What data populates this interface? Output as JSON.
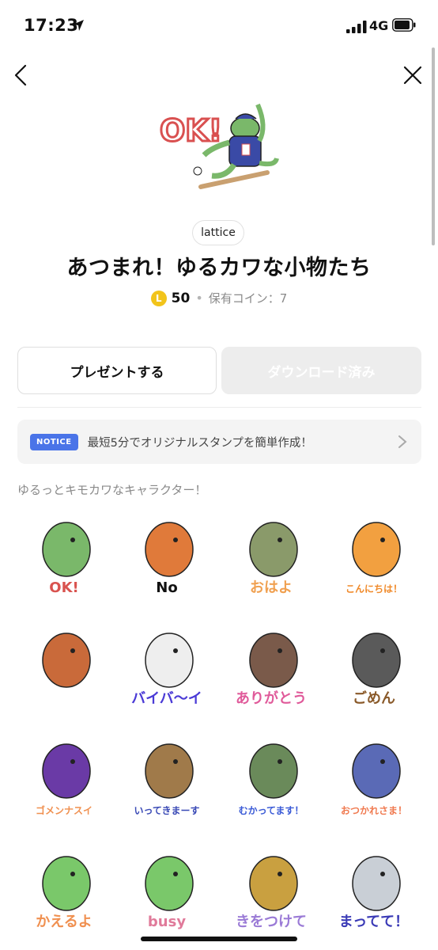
{
  "status_bar": {
    "time": "17:23",
    "network": "4G"
  },
  "nav": {
    "back_icon": "chevron-left-icon",
    "close_icon": "close-icon"
  },
  "hero": {
    "overlay_text": "OK!"
  },
  "author": "lattice",
  "title": "あつまれ！ゆるカワな小物たち",
  "price": {
    "coin_letter": "L",
    "amount": "50",
    "separator": "•",
    "owned": "保有コイン：7"
  },
  "buttons": {
    "present": "プレゼントする",
    "download": "ダウンロード済み"
  },
  "notice": {
    "badge": "NOTICE",
    "text": "最短5分でオリジナルスタンプを簡単作成！"
  },
  "description": "ゆるっとキモカワなキャラクター！",
  "stickers": [
    {
      "caption": "OK!",
      "color": "#d9534f"
    },
    {
      "caption": "No",
      "color": "#111111"
    },
    {
      "caption": "おはよ",
      "color": "#f0a050"
    },
    {
      "caption": "こんにちは！",
      "color": "#f08a2a"
    },
    {
      "caption": "",
      "color": "#d98a3a"
    },
    {
      "caption": "バイバ～イ",
      "color": "#4a3ad6"
    },
    {
      "caption": "ありがとう",
      "color": "#e05a9a"
    },
    {
      "caption": "ごめん",
      "color": "#8a5a2a"
    },
    {
      "caption": "ゴメンナスイ",
      "color": "#f09050"
    },
    {
      "caption": "いってきまーす",
      "color": "#3a4ab6"
    },
    {
      "caption": "むかってます！",
      "color": "#3a5ad6"
    },
    {
      "caption": "おつかれさま！",
      "color": "#f07a50"
    },
    {
      "caption": "かえるよ",
      "color": "#f09050"
    },
    {
      "caption": "busy",
      "color": "#e07a9a"
    },
    {
      "caption": "きをつけて",
      "color": "#9a7ad6"
    },
    {
      "caption": "まってて！",
      "color": "#3a3ab6"
    }
  ]
}
